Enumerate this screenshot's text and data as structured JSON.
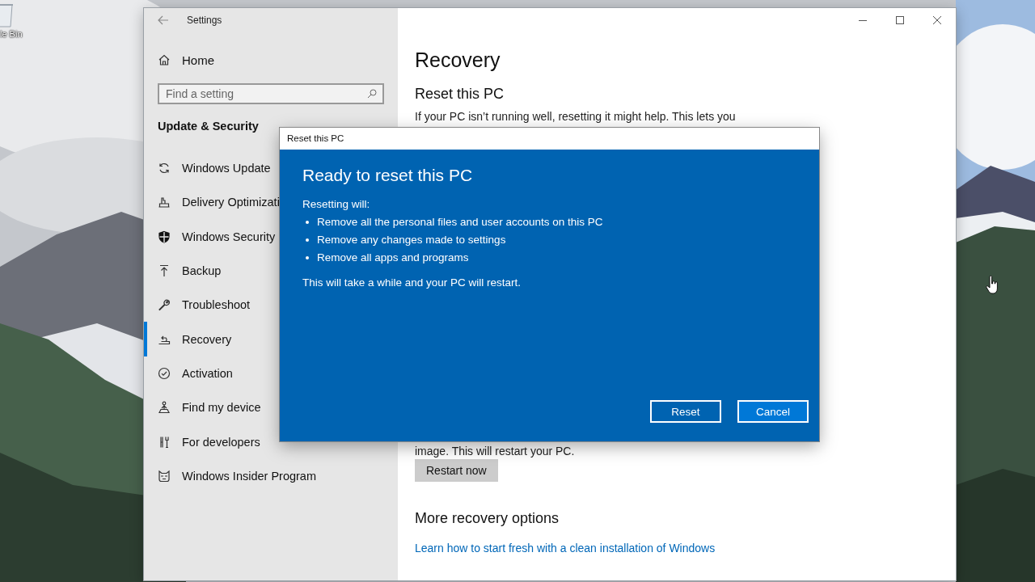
{
  "desktop": {
    "icon_label": "le Bin"
  },
  "settings": {
    "title": "Settings",
    "home": "Home",
    "search": {
      "placeholder": "Find a setting"
    },
    "section": "Update & Security",
    "nav": [
      {
        "label": "Windows Update",
        "selected": false
      },
      {
        "label": "Delivery Optimizati",
        "selected": false
      },
      {
        "label": "Windows Security",
        "selected": false
      },
      {
        "label": "Backup",
        "selected": false
      },
      {
        "label": "Troubleshoot",
        "selected": false
      },
      {
        "label": "Recovery",
        "selected": true
      },
      {
        "label": "Activation",
        "selected": false
      },
      {
        "label": "Find my device",
        "selected": false
      },
      {
        "label": "For developers",
        "selected": false
      },
      {
        "label": "Windows Insider Program",
        "selected": false
      }
    ],
    "page": {
      "title": "Recovery",
      "reset_heading": "Reset this PC",
      "reset_text": "If your PC isn’t running well, resetting it might help. This lets you",
      "restore_text": "image. This will restart your PC.",
      "restart_button": "Restart now",
      "more_heading": "More recovery options",
      "link": "Learn how to start fresh with a clean installation of Windows"
    }
  },
  "dialog": {
    "title": "Reset this PC",
    "heading": "Ready to reset this PC",
    "intro": "Resetting will:",
    "bullets": [
      "Remove all the personal files and user accounts on this PC",
      "Remove any changes made to settings",
      "Remove all apps and programs"
    ],
    "note": "This will take a while and your PC will restart.",
    "buttons": [
      {
        "label": "Reset",
        "default": false
      },
      {
        "label": "Cancel",
        "default": true
      }
    ]
  }
}
